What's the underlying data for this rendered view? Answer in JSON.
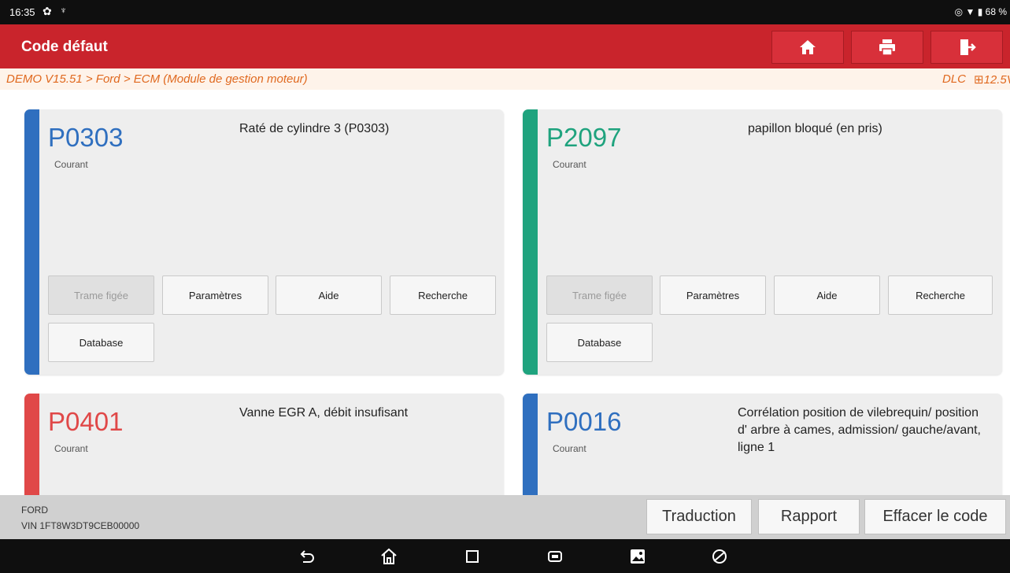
{
  "statusbar": {
    "time": "16:35",
    "battery": "68 %"
  },
  "header": {
    "title": "Code défaut"
  },
  "breadcrumb": {
    "path": "DEMO V15.51 > Ford > ECM (Module de gestion moteur)",
    "connection": "DLC",
    "voltage": "12.5V"
  },
  "colors": {
    "accent": "#c9242c",
    "blue": "#2f6fbf",
    "green": "#1fa37e",
    "red": "#e04848"
  },
  "cards": [
    {
      "code": "P0303",
      "status": "Courant",
      "description": "Raté de cylindre 3 (P0303)",
      "color": "#2f6fbf"
    },
    {
      "code": "P2097",
      "status": "Courant",
      "description": "papillon bloqué (en pris)",
      "color": "#1fa37e"
    },
    {
      "code": "P0401",
      "status": "Courant",
      "description": "Vanne EGR A, débit insufisant",
      "color": "#e04848"
    },
    {
      "code": "P0016",
      "status": "Courant",
      "description": "Corrélation position de vilebrequin/ position d' arbre à cames, admission/ gauche/avant, ligne 1",
      "color": "#2f6fbf"
    }
  ],
  "actions": {
    "freeze": "Trame figée",
    "params": "Paramètres",
    "help": "Aide",
    "search": "Recherche",
    "database": "Database"
  },
  "footer": {
    "brand": "FORD",
    "vin": "VIN 1FT8W3DT9CEB00000",
    "translate": "Traduction",
    "report": "Rapport",
    "clear": "Effacer le code"
  },
  "icons": {
    "home": "home-icon",
    "print": "printer-icon",
    "exit": "exit-icon"
  }
}
